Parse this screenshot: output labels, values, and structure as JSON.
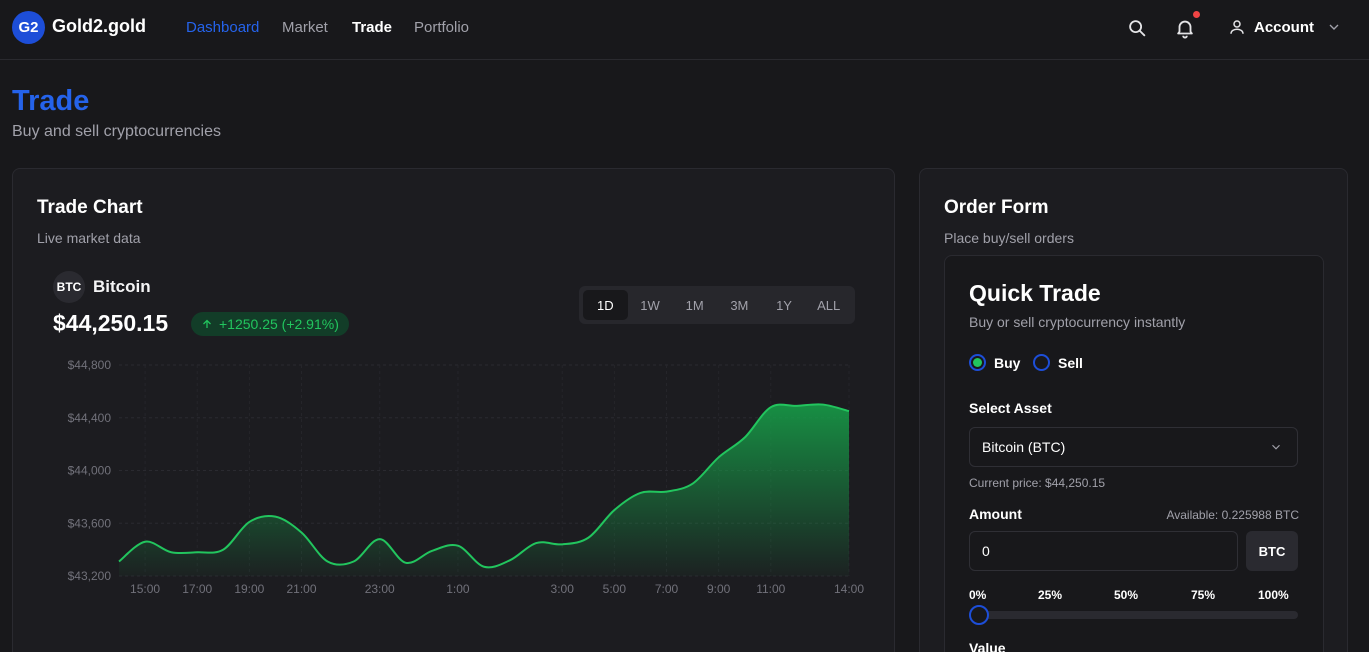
{
  "app": {
    "logo_text": "G2",
    "brand": "Gold2.gold",
    "nav": [
      {
        "label": "Dashboard"
      },
      {
        "label": "Market"
      },
      {
        "label": "Trade"
      },
      {
        "label": "Portfolio"
      }
    ],
    "account_label": "Account"
  },
  "page": {
    "title": "Trade",
    "subtitle": "Buy and sell cryptocurrencies"
  },
  "chart_card": {
    "title": "Trade Chart",
    "subtitle": "Live market data",
    "asset_badge": "BTC",
    "asset_name": "Bitcoin",
    "price": "$44,250.15",
    "change": "+1250.25 (+2.91%)",
    "ranges": [
      "1D",
      "1W",
      "1M",
      "3M",
      "1Y",
      "ALL"
    ],
    "selected_range": "1D"
  },
  "chart_data": {
    "type": "area",
    "x": [
      "14:00",
      "15:00",
      "16:00",
      "17:00",
      "18:00",
      "19:00",
      "20:00",
      "21:00",
      "22:00",
      "22:30",
      "23:00",
      "23:30",
      "0:00",
      "1:00",
      "1:30",
      "2:00",
      "2:30",
      "3:00",
      "4:00",
      "5:00",
      "6:00",
      "7:00",
      "8:00",
      "9:00",
      "10:00",
      "11:00",
      "12:00",
      "13:00",
      "14:00"
    ],
    "values": [
      43310,
      43460,
      43380,
      43380,
      43400,
      43610,
      43650,
      43530,
      43310,
      43310,
      43480,
      43300,
      43390,
      43430,
      43270,
      43320,
      43450,
      43440,
      43490,
      43700,
      43830,
      43840,
      43900,
      44100,
      44250,
      44480,
      44490,
      44500,
      44450
    ],
    "x_ticks": [
      "15:00",
      "17:00",
      "19:00",
      "21:00",
      "23:00",
      "1:00",
      "3:00",
      "5:00",
      "7:00",
      "9:00",
      "11:00",
      "14:00"
    ],
    "y_ticks": [
      "$44,800",
      "$44,400",
      "$44,000",
      "$43,600",
      "$43,200"
    ],
    "ylim": [
      43200,
      44800
    ],
    "grid": true,
    "line_color": "#22c55e",
    "fill_color": "#16a34a"
  },
  "order_card": {
    "title": "Order Form",
    "subtitle": "Place buy/sell orders",
    "quick_title": "Quick Trade",
    "quick_subtitle": "Buy or sell cryptocurrency instantly",
    "side_options": [
      {
        "label": "Buy",
        "selected": true
      },
      {
        "label": "Sell",
        "selected": false
      }
    ],
    "asset_label": "Select Asset",
    "asset_value": "Bitcoin (BTC)",
    "current_price": "Current price: $44,250.15",
    "amount_label": "Amount",
    "available": "Available: 0.225988 BTC",
    "amount_value": "0",
    "amount_unit": "BTC",
    "percent_options": [
      "0%",
      "25%",
      "50%",
      "75%",
      "100%"
    ],
    "slider_value": 0,
    "value_label": "Value"
  },
  "colors": {
    "accent": "#2563eb",
    "positive": "#22c55e",
    "notification": "#ef4444",
    "background": "#18181b"
  }
}
